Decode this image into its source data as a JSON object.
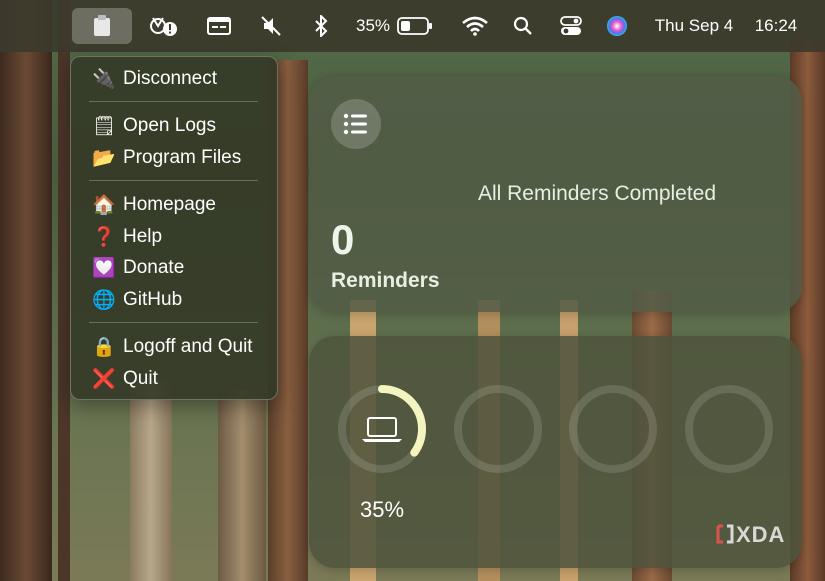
{
  "menubar": {
    "battery_percent": "35%",
    "date": "Thu Sep 4",
    "time": "16:24"
  },
  "menu": {
    "items": [
      {
        "label": "Disconnect",
        "icon": "plug-icon",
        "glyph": "🔌"
      },
      {
        "label": "Open Logs",
        "icon": "notepad-icon",
        "glyph": "🗒"
      },
      {
        "label": "Program Files",
        "icon": "folder-icon",
        "glyph": "📂"
      },
      {
        "label": "Homepage",
        "icon": "house-icon",
        "glyph": "🏠"
      },
      {
        "label": "Help",
        "icon": "question-icon",
        "glyph": "❓"
      },
      {
        "label": "Donate",
        "icon": "heart-icon",
        "glyph": "💟"
      },
      {
        "label": "GitHub",
        "icon": "globe-icon",
        "glyph": "🌐"
      },
      {
        "label": "Logoff and Quit",
        "icon": "lock-icon",
        "glyph": "🔒"
      },
      {
        "label": "Quit",
        "icon": "cross-icon",
        "glyph": "❌"
      }
    ]
  },
  "reminders_widget": {
    "status": "All Reminders Completed",
    "count": "0",
    "label": "Reminders"
  },
  "battery_widget": {
    "percent_label": "35%",
    "level": 0.35,
    "accent": "#f3f4c0"
  },
  "watermark": "XDA"
}
